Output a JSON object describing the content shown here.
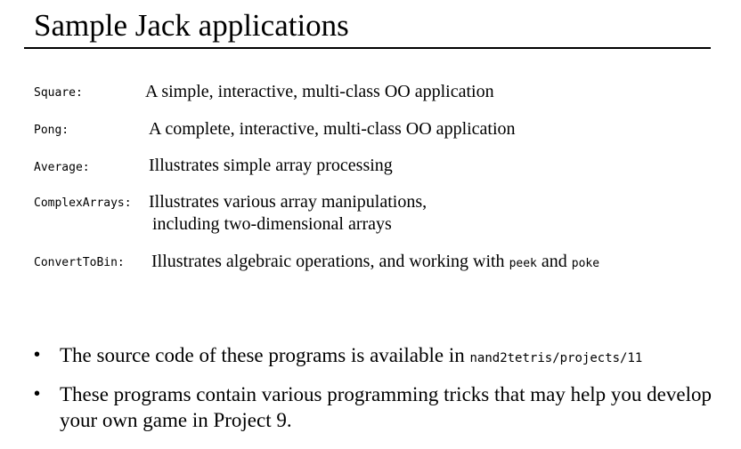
{
  "slide": {
    "title": "Sample Jack applications"
  },
  "apps": [
    {
      "name": "Square:",
      "description": "A simple, interactive, multi-class OO application"
    },
    {
      "name": "Pong:",
      "description": "A complete, interactive, multi-class OO application"
    },
    {
      "name": "Average:",
      "description": "Illustrates simple array processing"
    },
    {
      "name": "ComplexArrays:",
      "description_line1": "Illustrates various array manipulations,",
      "description_line2": "including two-dimensional arrays"
    },
    {
      "name": "ConvertToBin:",
      "description_prefix": "Illustrates algebraic operations, and working with",
      "code1": "peek",
      "conjunction": "and",
      "code2": "poke"
    }
  ],
  "bullets": [
    {
      "text": "The source code of these programs is available in",
      "code": "nand2tetris/projects/11"
    },
    {
      "text": "These programs contain various programming tricks that may help you develop your own game in Project 9."
    }
  ],
  "bullet_symbol": "•"
}
